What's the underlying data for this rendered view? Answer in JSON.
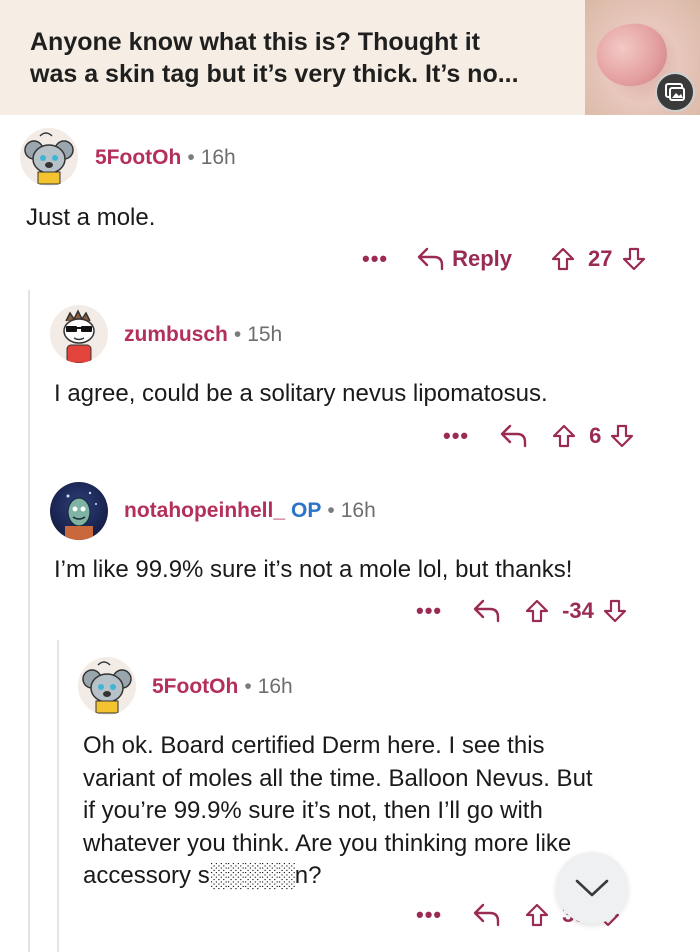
{
  "post": {
    "title_line1": "Anyone know what this is? Thought it",
    "title_line2": "was a skin tag but it’s very thick. It’s no..."
  },
  "comments": [
    {
      "username": "5FootOh",
      "time": "16h",
      "body": "Just a mole.",
      "reply_label": "Reply",
      "score": "27"
    },
    {
      "username": "zumbusch",
      "time": "15h",
      "body": "I agree, could be a solitary nevus lipomatosus.",
      "score": "6"
    },
    {
      "username": "notahopeinhell_",
      "op_tag": "OP",
      "time": "16h",
      "body": "I’m like 99.9% sure it’s not a mole lol, but thanks!",
      "score": "-34"
    },
    {
      "username": "5FootOh",
      "time": "16h",
      "body_lines": [
        "Oh ok. Board certified Derm here. I see this",
        "variant of moles all the time. Balloon Nevus. But",
        "if you’re 99.9% sure it’s not, then I’ll go with",
        "whatever you think. Are you thinking more like",
        "accessory s░░░░░n?"
      ],
      "score": "33"
    }
  ],
  "ui": {
    "more_dots": "•••",
    "separator": "•",
    "accent": "#9a2b54",
    "username_color": "#b3305a",
    "op_color": "#2c74c9"
  }
}
